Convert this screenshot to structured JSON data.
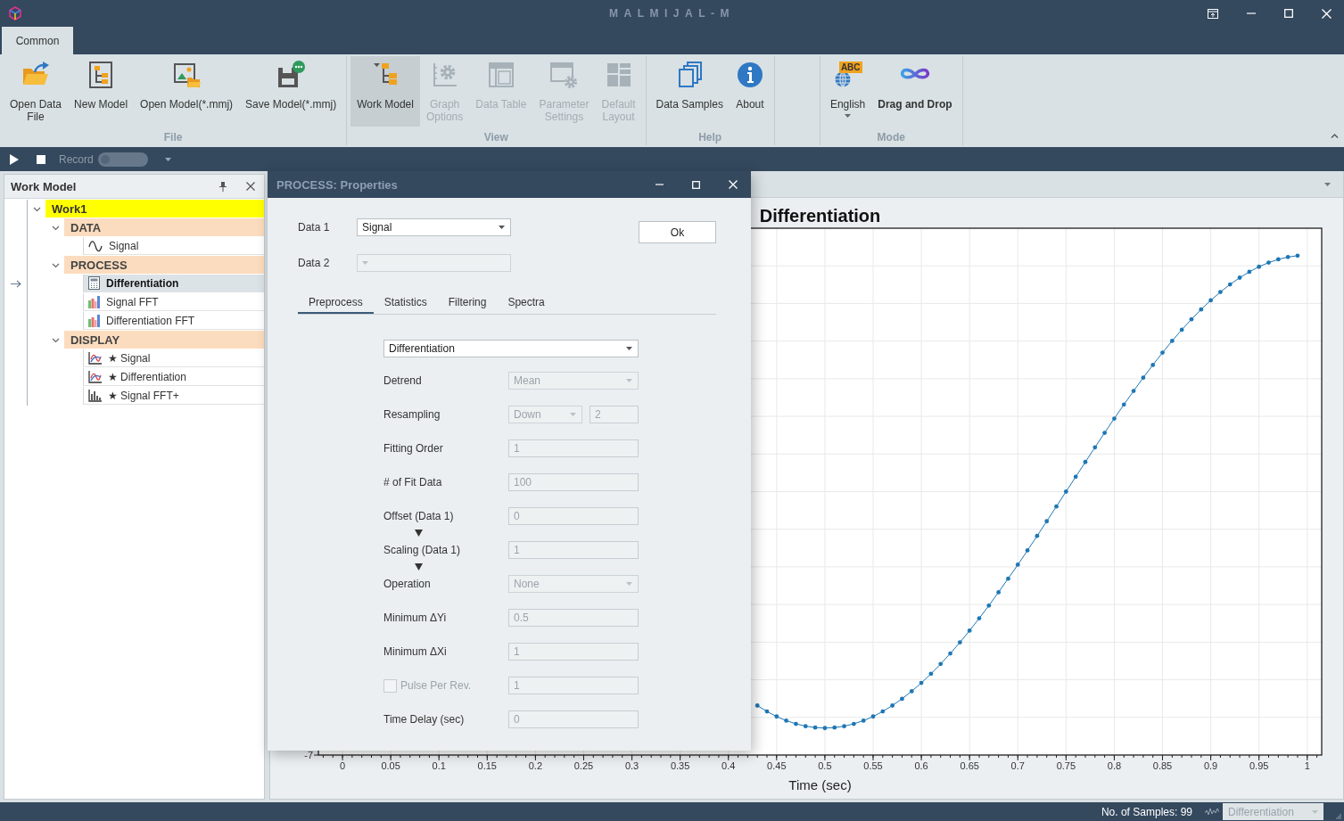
{
  "window": {
    "title": "MALMIJAL-M"
  },
  "ribbon": {
    "tabs": [
      {
        "label": "Common",
        "selected": true
      }
    ],
    "groups": [
      {
        "label": "File",
        "buttons": [
          {
            "label": "Open Data\nFile",
            "disabled": false,
            "pressed": false,
            "active": false,
            "menu": false
          },
          {
            "label": "New Model",
            "disabled": false,
            "pressed": false,
            "active": false,
            "menu": false
          },
          {
            "label": "Open Model(*.mmj)",
            "disabled": false,
            "pressed": false,
            "active": false,
            "menu": false
          },
          {
            "label": "Save Model(*.mmj)",
            "disabled": false,
            "pressed": false,
            "active": false,
            "menu": false
          }
        ]
      },
      {
        "label": "View",
        "buttons": [
          {
            "label": "Work Model",
            "disabled": false,
            "pressed": true,
            "active": false,
            "menu": false
          },
          {
            "label": "Graph\nOptions",
            "disabled": true,
            "pressed": false,
            "active": false,
            "menu": false
          },
          {
            "label": "Data Table",
            "disabled": true,
            "pressed": false,
            "active": false,
            "menu": false
          },
          {
            "label": "Parameter\nSettings",
            "disabled": true,
            "pressed": false,
            "active": false,
            "menu": false
          },
          {
            "label": "Default\nLayout",
            "disabled": true,
            "pressed": false,
            "active": false,
            "menu": false
          }
        ]
      },
      {
        "label": "Help",
        "buttons": [
          {
            "label": "Data Samples",
            "disabled": false,
            "pressed": false,
            "active": false,
            "menu": false
          },
          {
            "label": "About",
            "disabled": false,
            "pressed": false,
            "active": false,
            "menu": false
          }
        ]
      },
      {
        "label": "Mode",
        "buttons": [
          {
            "label": "English",
            "badge": "ABC",
            "disabled": false,
            "pressed": false,
            "active": false,
            "menu": true
          },
          {
            "label": "Drag and Drop",
            "disabled": false,
            "pressed": false,
            "active": true,
            "menu": false
          }
        ]
      }
    ]
  },
  "toolbar": {
    "record": {
      "label": "Record",
      "on": false
    }
  },
  "work_model": {
    "title": "Work Model",
    "tree": [
      {
        "label": "Work1",
        "kind": "root",
        "expanded": true,
        "selected": false,
        "children": [
          {
            "label": "DATA",
            "kind": "group",
            "expanded": true,
            "selected": false,
            "children": [
              {
                "label": "Signal",
                "kind": "signal",
                "selected": false
              }
            ]
          },
          {
            "label": "PROCESS",
            "kind": "group",
            "expanded": true,
            "selected": false,
            "children": [
              {
                "label": "Differentiation",
                "kind": "process",
                "selected": true
              },
              {
                "label": "Signal FFT",
                "kind": "fft",
                "selected": false
              },
              {
                "label": "Differentiation FFT",
                "kind": "fft",
                "selected": false
              }
            ]
          },
          {
            "label": "DISPLAY",
            "kind": "group",
            "expanded": true,
            "selected": false,
            "children": [
              {
                "label": "★ Signal",
                "kind": "plot",
                "selected": false
              },
              {
                "label": "★ Differentiation",
                "kind": "plot",
                "selected": false
              },
              {
                "label": "★ Signal FFT+",
                "kind": "spectrum-plot",
                "selected": false
              }
            ]
          }
        ]
      }
    ]
  },
  "dialog": {
    "title": "PROCESS: Properties",
    "data_1": {
      "label": "Data 1",
      "value": "Signal",
      "disabled": false
    },
    "data_2": {
      "label": "Data 2",
      "disabled": true
    },
    "ok_label": "Ok",
    "tabs": [
      {
        "label": "Preprocess",
        "selected": true
      },
      {
        "label": "Statistics",
        "selected": false
      },
      {
        "label": "Filtering",
        "selected": false
      },
      {
        "label": "Spectra",
        "selected": false
      }
    ],
    "method": {
      "value": "Differentiation",
      "disabled": false
    },
    "rows": [
      {
        "kind": "select",
        "label": "Detrend",
        "value": "Mean",
        "disabled": true
      },
      {
        "kind": "pair",
        "label": "Resampling",
        "value": "Down",
        "value_2": "2",
        "disabled": true
      },
      {
        "kind": "input",
        "label": "Fitting Order",
        "value": "1",
        "disabled": true
      },
      {
        "kind": "input",
        "label": "# of Fit Data",
        "value": "100",
        "disabled": true
      },
      {
        "kind": "input",
        "label": "Offset (Data 1)",
        "value": "0",
        "disabled": true
      },
      {
        "kind": "arrow"
      },
      {
        "kind": "input",
        "label": "Scaling (Data 1)",
        "value": "1",
        "disabled": true
      },
      {
        "kind": "arrow"
      },
      {
        "kind": "select",
        "label": "Operation",
        "value": "None",
        "disabled": true
      },
      {
        "kind": "input",
        "label": "Minimum ΔYi",
        "value": "0.5",
        "disabled": true
      },
      {
        "kind": "input",
        "label": "Minimum ΔXi",
        "value": "1",
        "disabled": true
      },
      {
        "kind": "check",
        "label": "Pulse Per Rev.",
        "checked": false,
        "value": "1",
        "disabled": true
      },
      {
        "kind": "input",
        "label": "Time Delay (sec)",
        "value": "0",
        "disabled": true
      }
    ]
  },
  "plot": {
    "title": "Differentiation",
    "grid": true,
    "x_axis": {
      "ticks": [
        "0",
        "0.05",
        "0.1",
        "0.15",
        "0.2",
        "0.25",
        "0.3",
        "0.35",
        "0.4",
        "0.45",
        "0.5",
        "0.55",
        "0.6",
        "0.65",
        "0.7",
        "0.75",
        "0.8",
        "0.85",
        "0.9",
        "0.95",
        "1"
      ],
      "title": "Time (sec)"
    },
    "y_axis": {
      "ticks": [
        "-7"
      ]
    }
  },
  "status_bar": {
    "samples": "No. of Samples: 99",
    "view": {
      "value": "Differentiation",
      "disabled": true
    }
  }
}
